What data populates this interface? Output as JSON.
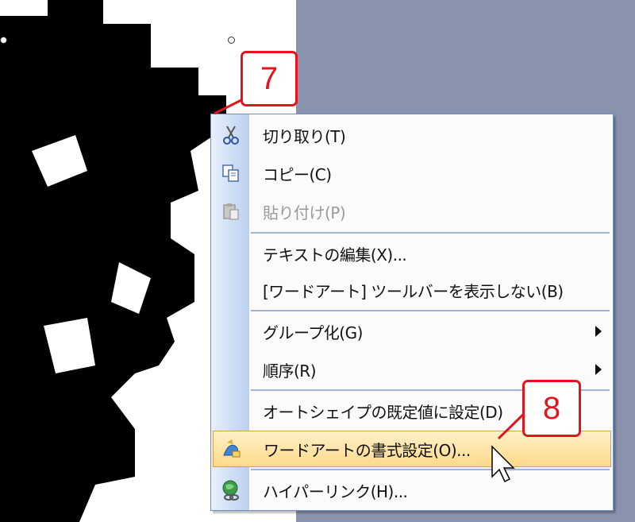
{
  "callouts": {
    "step7": "7",
    "step8": "8"
  },
  "context_menu": {
    "items": [
      {
        "label": "切り取り(T)",
        "icon": "scissors-icon",
        "enabled": true
      },
      {
        "label": "コピー(C)",
        "icon": "copy-icon",
        "enabled": true
      },
      {
        "label": "貼り付け(P)",
        "icon": "paste-icon",
        "enabled": false
      },
      {
        "label": "テキストの編集(X)...",
        "enabled": true
      },
      {
        "label": "[ワードアート] ツールバーを表示しない(B)",
        "enabled": true
      },
      {
        "label": "グループ化(G)",
        "enabled": true,
        "submenu": true
      },
      {
        "label": "順序(R)",
        "enabled": true,
        "submenu": true
      },
      {
        "label": "オートシェイプの既定値に設定(D)",
        "enabled": true
      },
      {
        "label": "ワードアートの書式設定(O)...",
        "icon": "format-wordart-icon",
        "enabled": true,
        "highlighted": true
      },
      {
        "label": "ハイパーリンク(H)...",
        "icon": "hyperlink-globe-icon",
        "enabled": true
      }
    ]
  },
  "colors": {
    "callout_red": "#e2141c",
    "menu_border": "#6f8fc9",
    "highlight": "#ffd98a",
    "desktop_bg": "#8a93ad"
  }
}
